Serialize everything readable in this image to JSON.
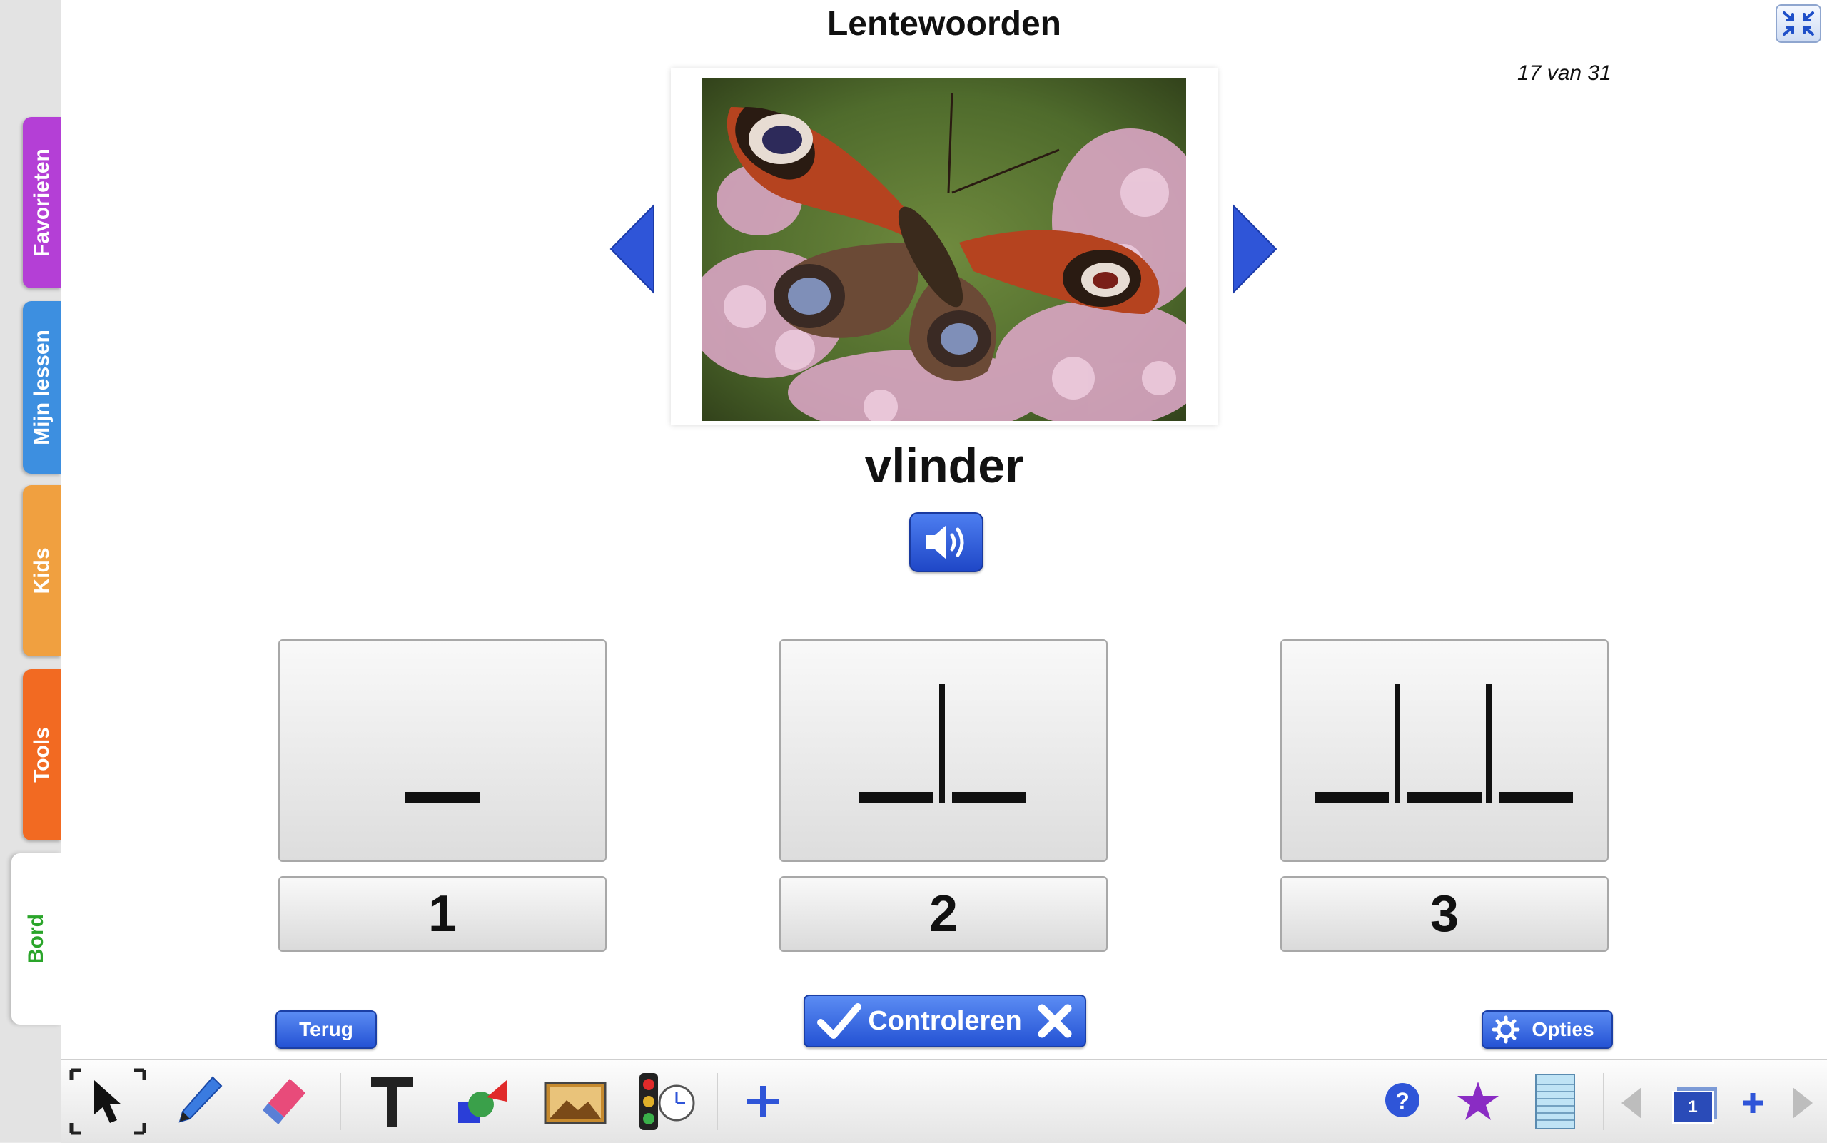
{
  "header": {
    "title": "Lentewoorden",
    "counter": "17 van 31"
  },
  "sidebar": {
    "tabs": [
      {
        "label": "Favorieten",
        "color": "#b43fd6"
      },
      {
        "label": "Mijn lessen",
        "color": "#3d8fe0"
      },
      {
        "label": "Kids",
        "color": "#f0a040"
      },
      {
        "label": "Tools",
        "color": "#f26a22"
      },
      {
        "label": "Bord",
        "color": "#2aa52a"
      }
    ]
  },
  "exercise": {
    "word": "vlinder",
    "choices": [
      {
        "label": "1"
      },
      {
        "label": "2"
      },
      {
        "label": "3"
      }
    ]
  },
  "buttons": {
    "back": "Terug",
    "check": "Controleren",
    "options": "Opties"
  },
  "toolbar": {
    "page_number": "1"
  },
  "icons": [
    "collapse-icon",
    "prev-arrow-icon",
    "next-arrow-icon",
    "speaker-icon",
    "checkmark-icon",
    "cross-icon",
    "gear-icon",
    "pointer-icon",
    "pen-icon",
    "eraser-icon",
    "text-icon",
    "shapes-icon",
    "image-icon",
    "traffic-light-timer-icon",
    "plus-icon",
    "help-icon",
    "star-icon",
    "notes-icon",
    "page-icon"
  ],
  "colors": {
    "accent": "#2452d4",
    "active_tab": "#2aa52a",
    "star": "#8a2cc4"
  }
}
